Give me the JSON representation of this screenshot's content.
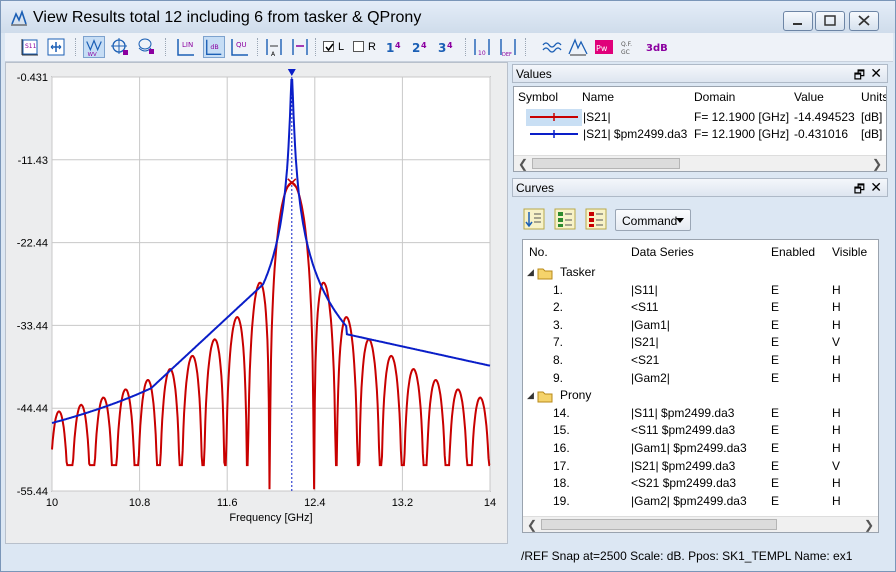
{
  "window": {
    "title": "View Results total 12 including 6 from tasker & QProny"
  },
  "toolbar": {
    "checkbox_L_label": "L",
    "checkbox_L_checked": true,
    "checkbox_R_label": "R",
    "checkbox_R_checked": false,
    "icons": [
      "s11-icon",
      "fit-icon",
      "markers-icon",
      "crosshair-icon",
      "layers-icon",
      "lin-scale-icon",
      "db-scale-icon",
      "qu-icon",
      "marker-a-icon",
      "marker-b-icon",
      "one-four-icon",
      "two-four-icon",
      "three-four-icon",
      "ten-icon",
      "def-icon",
      "wave-icon",
      "peak-icon",
      "pow-icon",
      "q-icon",
      "3db-icon"
    ]
  },
  "chart_data": {
    "type": "line",
    "xlabel": "Frequency [GHz]",
    "ylabel": "",
    "xlim": [
      10,
      14
    ],
    "ylim": [
      -55.44,
      -0.431
    ],
    "x_ticks": [
      "10",
      "10.8",
      "11.6",
      "12.4",
      "13.2",
      "14"
    ],
    "y_ticks": [
      "-0.431",
      "-11.43",
      "-22.44",
      "-33.44",
      "-44.44",
      "-55.44"
    ],
    "grid": true,
    "marker_x": 12.19,
    "series": [
      {
        "color": "#c80000",
        "values_at_marker": -14.494523
      },
      {
        "color": "#0a1ec8",
        "values_at_marker": -0.431016
      }
    ]
  },
  "values_panel": {
    "title": "Values",
    "headers": [
      "Symbol",
      "Name",
      "Domain",
      "Value",
      "Units"
    ],
    "rows": [
      {
        "name": "|S21|",
        "domain": "F= 12.1900 [GHz]",
        "value": "-14.494523",
        "units": "[dB]",
        "color": "#c80000"
      },
      {
        "name": "|S21|  $pm2499.da3",
        "domain": "F= 12.1900 [GHz]",
        "value": "-0.431016",
        "units": "[dB]",
        "color": "#0a1ec8"
      }
    ]
  },
  "curves_panel": {
    "title": "Curves",
    "command_label": "Command",
    "headers": [
      "No.",
      "Data Series",
      "Enabled",
      "Visible"
    ],
    "groups": [
      {
        "name": "Tasker",
        "rows": [
          {
            "no": "1.",
            "series": "|S11|",
            "enabled": "E",
            "visible": "H"
          },
          {
            "no": "2.",
            "series": "<S11",
            "enabled": "E",
            "visible": "H"
          },
          {
            "no": "3.",
            "series": "|Gam1|",
            "enabled": "E",
            "visible": "H"
          },
          {
            "no": "7.",
            "series": "|S21|",
            "enabled": "E",
            "visible": "V"
          },
          {
            "no": "8.",
            "series": "<S21",
            "enabled": "E",
            "visible": "H"
          },
          {
            "no": "9.",
            "series": "|Gam2|",
            "enabled": "E",
            "visible": "H"
          }
        ]
      },
      {
        "name": "Prony",
        "rows": [
          {
            "no": "14.",
            "series": "|S11|  $pm2499.da3",
            "enabled": "E",
            "visible": "H"
          },
          {
            "no": "15.",
            "series": "<S11  $pm2499.da3",
            "enabled": "E",
            "visible": "H"
          },
          {
            "no": "16.",
            "series": "|Gam1|  $pm2499.da3",
            "enabled": "E",
            "visible": "H"
          },
          {
            "no": "17.",
            "series": "|S21|  $pm2499.da3",
            "enabled": "E",
            "visible": "V"
          },
          {
            "no": "18.",
            "series": "<S21  $pm2499.da3",
            "enabled": "E",
            "visible": "H"
          },
          {
            "no": "19.",
            "series": "|Gam2|  $pm2499.da3",
            "enabled": "E",
            "visible": "H"
          }
        ]
      }
    ]
  },
  "status": {
    "text": "/REF  Snap at=2500     Scale: dB.  Ppos: SK1_TEMPL  Name: ex1"
  }
}
